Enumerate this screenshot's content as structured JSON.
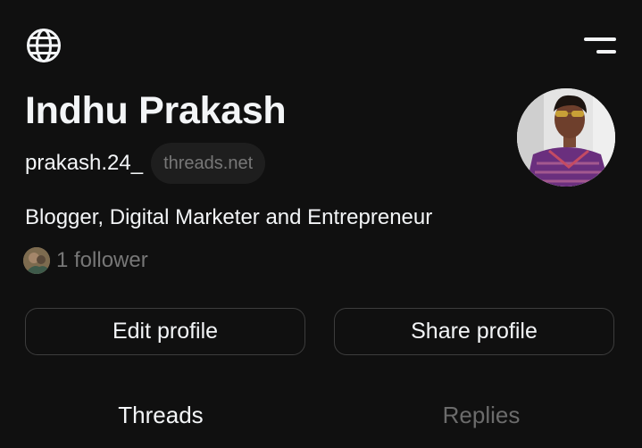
{
  "header": {
    "left_icon": "globe-icon",
    "right_icon": "menu-icon"
  },
  "profile": {
    "name": "Indhu Prakash",
    "handle": "prakash.24_",
    "domain_badge": "threads.net",
    "bio": "Blogger, Digital Marketer and Entrepreneur",
    "followers_text": "1 follower"
  },
  "actions": {
    "edit_label": "Edit profile",
    "share_label": "Share profile"
  },
  "tabs": [
    {
      "label": "Threads",
      "active": true
    },
    {
      "label": "Replies",
      "active": false
    }
  ],
  "colors": {
    "background": "#101010",
    "text_primary": "#f3f5f7",
    "text_secondary": "#777777",
    "border": "#3d3d3d"
  }
}
